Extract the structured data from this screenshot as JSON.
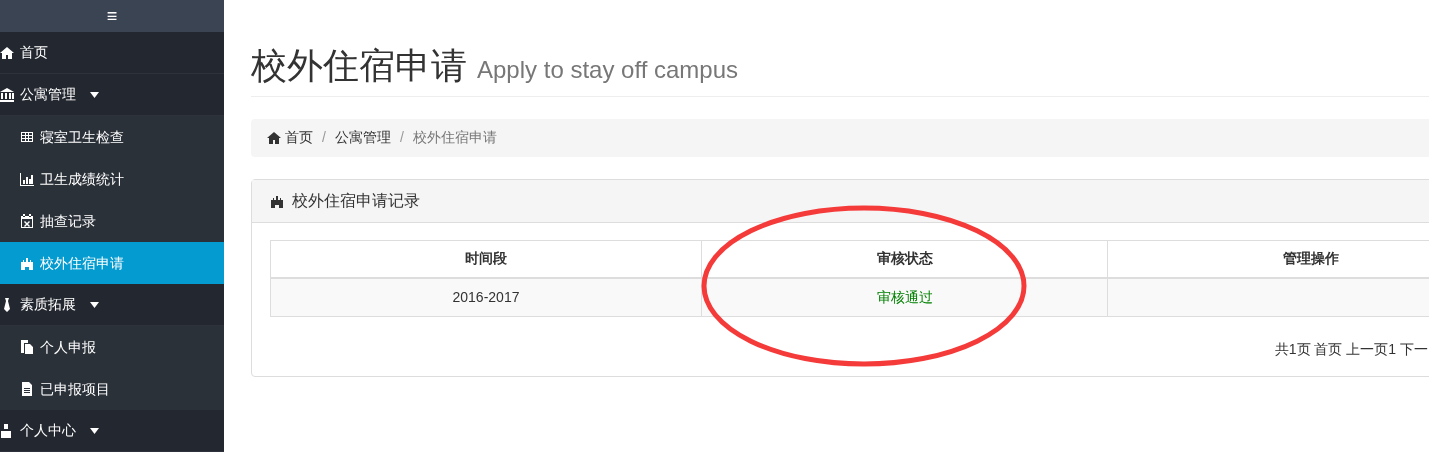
{
  "sidebar": {
    "toggle": "≡",
    "items": [
      {
        "label": "首页",
        "kind": "link",
        "selected": false
      },
      {
        "label": "公寓管理",
        "kind": "submenu",
        "selected": false,
        "expanded": true,
        "children": [
          {
            "label": "寝室卫生检查",
            "selected": false
          },
          {
            "label": "卫生成绩统计",
            "selected": false
          },
          {
            "label": "抽查记录",
            "selected": false
          },
          {
            "label": "校外住宿申请",
            "selected": true
          }
        ]
      },
      {
        "label": "素质拓展",
        "kind": "submenu",
        "selected": false,
        "expanded": true,
        "children": [
          {
            "label": "个人申报",
            "selected": false
          },
          {
            "label": "已申报项目",
            "selected": false
          }
        ]
      },
      {
        "label": "个人中心",
        "kind": "submenu",
        "selected": false
      }
    ]
  },
  "page": {
    "title": "校外住宿申请",
    "subtitle": "Apply to stay off campus"
  },
  "breadcrumb": {
    "separator": "/",
    "items": [
      {
        "label": "首页",
        "active": false
      },
      {
        "label": "公寓管理",
        "active": false
      },
      {
        "label": "校外住宿申请",
        "active": true
      }
    ]
  },
  "panel": {
    "title": "校外住宿申请记录",
    "table": {
      "columns": [
        "时间段",
        "审核状态",
        "管理操作"
      ],
      "rows": [
        {
          "period": "2016-2017",
          "status": "审核通过"
        }
      ]
    },
    "pagination": "共1页 首页 上一页1 下一"
  },
  "annotation": {
    "kind": "ellipse"
  }
}
